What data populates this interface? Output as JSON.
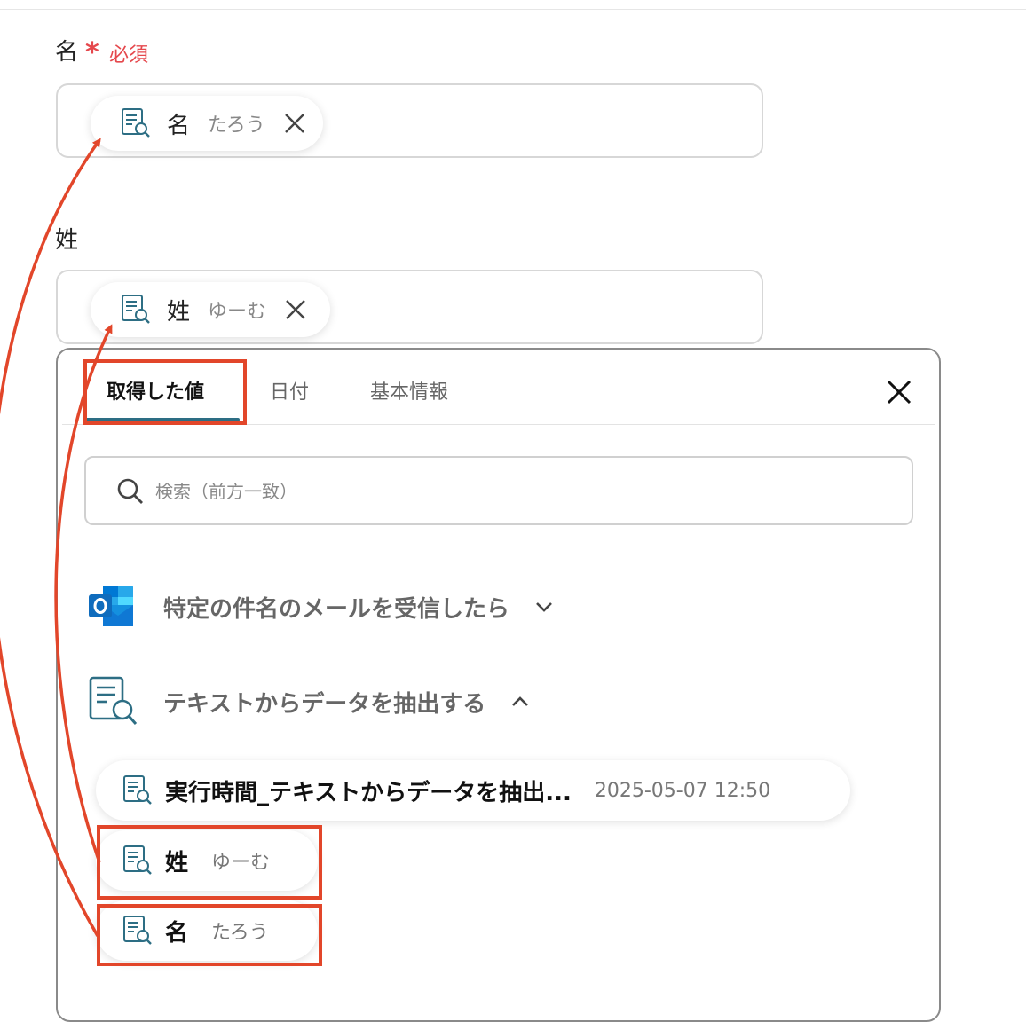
{
  "form": {
    "first_name": {
      "label": "名",
      "required_star": "*",
      "required_text": "必須",
      "token": {
        "name": "名",
        "value": "たろう"
      }
    },
    "last_name": {
      "label": "姓",
      "token": {
        "name": "姓",
        "value": "ゆーむ"
      }
    }
  },
  "picker": {
    "tabs": [
      {
        "label": "取得した値",
        "active": true
      },
      {
        "label": "日付",
        "active": false
      },
      {
        "label": "基本情報",
        "active": false
      }
    ],
    "search_placeholder": "検索（前方一致）",
    "sections": [
      {
        "title": "特定の件名のメールを受信したら",
        "icon": "outlook-icon",
        "expanded": false
      },
      {
        "title": "テキストからデータを抽出する",
        "icon": "document-search-icon",
        "expanded": true
      }
    ],
    "items": [
      {
        "name": "実行時間_テキストからデータを抽出...",
        "value": "2025-05-07 12:50"
      },
      {
        "name": "姓",
        "value": "ゆーむ"
      },
      {
        "name": "名",
        "value": "たろう"
      }
    ]
  },
  "colors": {
    "required": "#e5484d",
    "highlight": "#e2462a",
    "icon_teal": "#2d6e84",
    "outlook_blue": "#0f6cbd"
  }
}
